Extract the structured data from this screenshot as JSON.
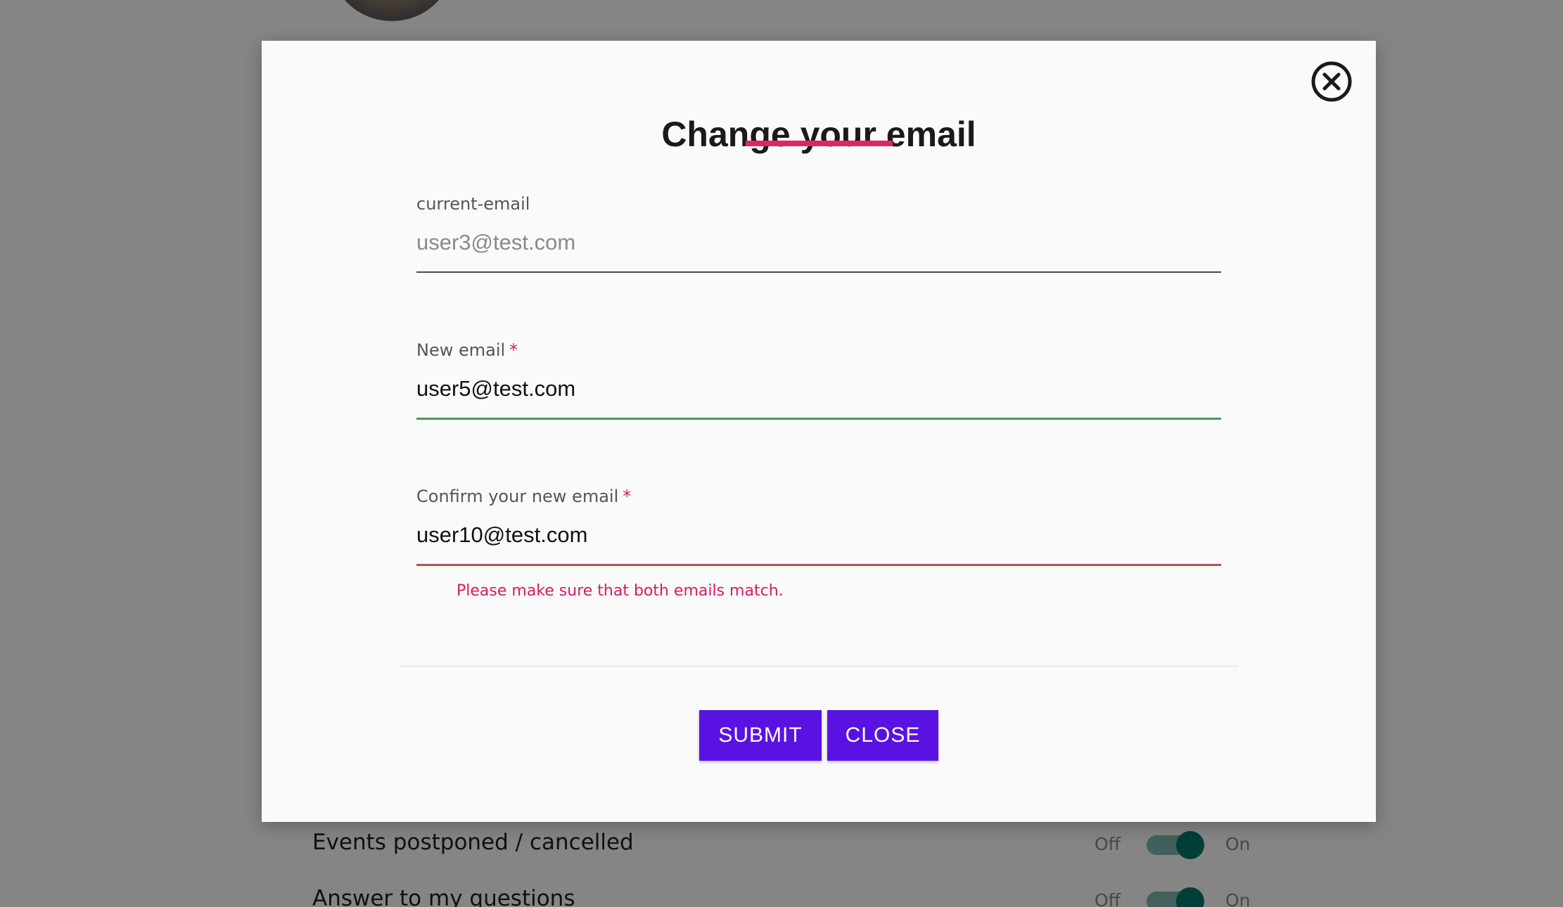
{
  "background": {
    "settings_rows": [
      {
        "label": "Events postponed / cancelled",
        "off_label": "Off",
        "on_label": "On",
        "state": "on"
      },
      {
        "label": "Answer to my questions",
        "off_label": "Off",
        "on_label": "On",
        "state": "on"
      }
    ]
  },
  "modal": {
    "title": "Change your email",
    "accent_color": "#e0246a",
    "close_icon": "circle-x-icon",
    "fields": {
      "current": {
        "label": "current-email",
        "value": "user3@test.com",
        "disabled": true
      },
      "new": {
        "label": "New email",
        "required_mark": "*",
        "value": "user5@test.com",
        "status": "valid"
      },
      "confirm": {
        "label": "Confirm your new email",
        "required_mark": "*",
        "value": "user10@test.com",
        "status": "invalid",
        "error": "Please make sure that both emails match."
      }
    },
    "buttons": {
      "submit_label": "SUBMIT",
      "close_label": "CLOSE",
      "color": "#5a12e3"
    }
  }
}
